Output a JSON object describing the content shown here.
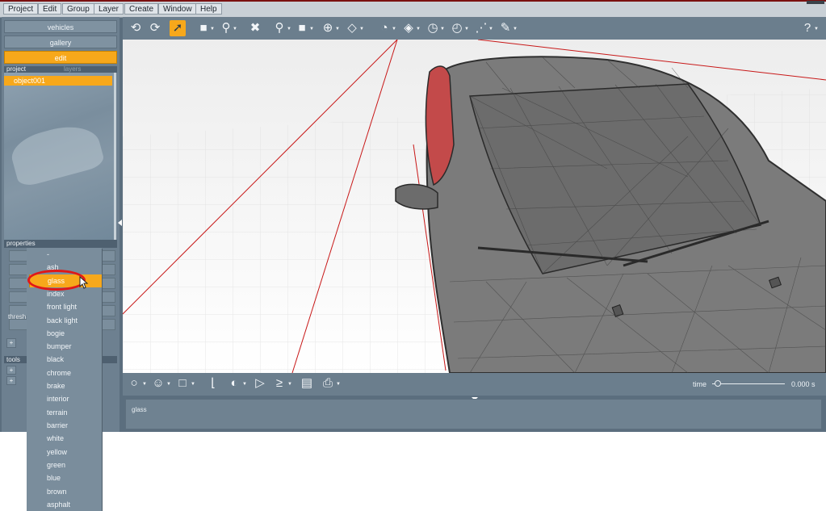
{
  "menubar": {
    "items": [
      "Project",
      "Edit",
      "Group",
      "Layer",
      "Create",
      "Window",
      "Help"
    ]
  },
  "left_panel": {
    "buttons": {
      "vehicles": "vehicles",
      "gallery": "gallery",
      "edit": "edit"
    },
    "tabs": {
      "project": "project",
      "layers": "layers"
    },
    "project_items": [
      "object001"
    ],
    "properties_header": "properties",
    "threshold_label": "thresh",
    "tools_header": "tools",
    "plus": "+"
  },
  "toolbar": {
    "icons": [
      "undo-icon",
      "redo-icon",
      "select-arrow-icon",
      "box-select-icon",
      "lasso-icon",
      "delete-icon",
      "zoom-icon",
      "display-mode-icon",
      "transform-gizmo-icon",
      "paint-icon",
      "rotate-view-icon",
      "material-icon",
      "measure-icon",
      "clock-icon",
      "path-icon",
      "pen-icon",
      "help-icon"
    ]
  },
  "timeline": {
    "time_label": "time",
    "time_value": "0.000 s"
  },
  "status": {
    "text": "glass"
  },
  "material_dropdown": {
    "items": [
      "-",
      "ash",
      "glass",
      "index",
      "front light",
      "back light",
      "bogie",
      "bumper",
      "black",
      "chrome",
      "brake",
      "interior",
      "terrain",
      "barrier",
      "white",
      "yellow",
      "green",
      "blue",
      "brown",
      "asphalt"
    ],
    "selected": "glass"
  },
  "colors": {
    "accent": "#f7a81b",
    "panel": "#6d8090",
    "annotation": "#e01818",
    "wire_red": "#c81818"
  }
}
